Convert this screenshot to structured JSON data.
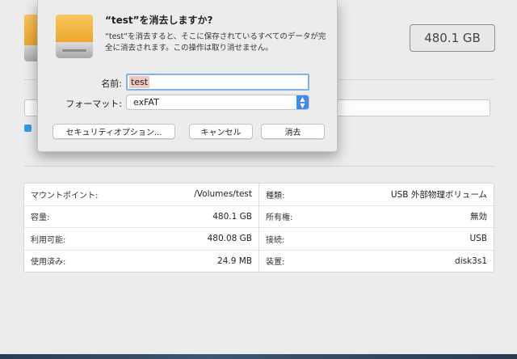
{
  "background": {
    "capacity_box": "480.1 GB",
    "info_table": {
      "left": [
        {
          "label": "マウントポイント:",
          "value": "/Volumes/test"
        },
        {
          "label": "容量:",
          "value": "480.1 GB"
        },
        {
          "label": "利用可能:",
          "value": "480.08 GB"
        },
        {
          "label": "使用済み:",
          "value": "24.9 MB"
        }
      ],
      "right": [
        {
          "label": "種類:",
          "value": "USB 外部物理ボリューム"
        },
        {
          "label": "所有権:",
          "value": "無効"
        },
        {
          "label": "接続:",
          "value": "USB"
        },
        {
          "label": "装置:",
          "value": "disk3s1"
        }
      ]
    }
  },
  "dialog": {
    "icon": "external-drive-icon",
    "title": "“test”を消去しますか?",
    "message": "“test”を消去すると、そこに保存されているすべてのデータが完全に消去されます。この操作は取り消せません。",
    "name_label": "名前:",
    "name_value": "test",
    "format_label": "フォーマット:",
    "format_value": "exFAT",
    "buttons": {
      "security": "セキュリティオプション...",
      "cancel": "キャンセル",
      "erase": "消去"
    }
  },
  "colors": {
    "accent": "#3d89f1",
    "focus_ring": "#7fb0f0",
    "drive_orange": "#f0b540"
  }
}
